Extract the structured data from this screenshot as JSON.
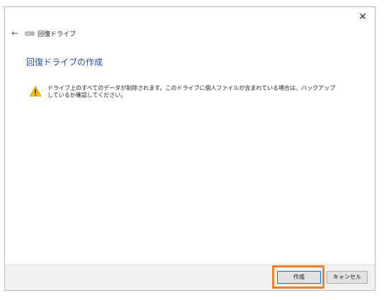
{
  "window": {
    "close_glyph": "✕"
  },
  "nav": {
    "back_glyph": "←",
    "title": "回復ドライブ"
  },
  "page": {
    "heading": "回復ドライブの作成",
    "warning_line1": "ドライブ上のすべてのデータが削除されます。このドライブに個人ファイルが含まれている場合は、バックアップ",
    "warning_line2": "しているか確認してください。"
  },
  "footer": {
    "create_label": "作成",
    "cancel_label": "キャンセル"
  },
  "colors": {
    "heading": "#1c4fa3",
    "highlight": "#f58220",
    "warning": "#f5c400"
  },
  "icons": {
    "back": "back-arrow-icon",
    "drive": "drive-icon",
    "warning": "warning-icon",
    "close": "close-icon"
  }
}
